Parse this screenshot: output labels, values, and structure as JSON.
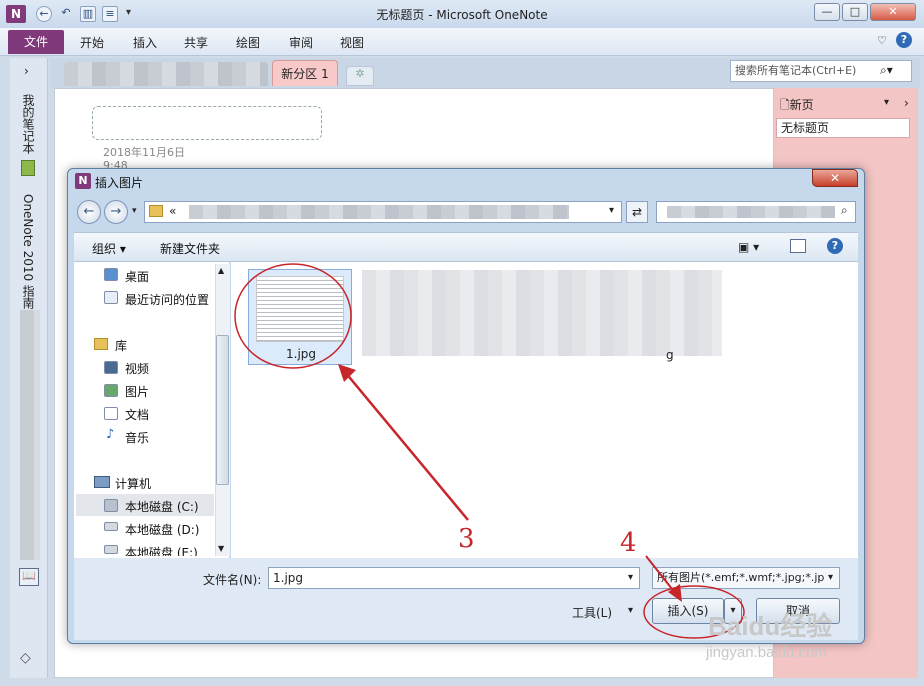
{
  "window": {
    "title": "无标题页 - Microsoft OneNote",
    "logo_letter": "N"
  },
  "ribbon": {
    "file": "文件",
    "tabs": [
      "开始",
      "插入",
      "共享",
      "绘图",
      "审阅",
      "视图"
    ]
  },
  "notebooks": {
    "item1": "我的笔记本",
    "item2": "OneNote 2010 指南"
  },
  "sections": {
    "active_tab": "新分区 1",
    "new_tab_symbol": "✲"
  },
  "search": {
    "placeholder": "搜索所有笔记本(Ctrl+E)"
  },
  "page": {
    "date": "2018年11月6日",
    "time": "9:48"
  },
  "pagelist": {
    "new_page": "新页",
    "current_page": "无标题页"
  },
  "dialog": {
    "title": "插入图片",
    "address_prefix": "«",
    "organize": "组织 ▾",
    "new_folder": "新建文件夹",
    "nav": {
      "favorites": [
        "桌面",
        "最近访问的位置"
      ],
      "library": "库",
      "library_items": [
        "视频",
        "图片",
        "文档",
        "音乐"
      ],
      "computer": "计算机",
      "drives": [
        "本地磁盘 (C:)",
        "本地磁盘 (D:)",
        "本地磁盘 (E:)"
      ]
    },
    "file_selected": "1.jpg",
    "file_other_label": "g",
    "filename_label": "文件名(N):",
    "filename_value": "1.jpg",
    "filetype_value": "所有图片(*.emf;*.wmf;*.jpg;*.jp",
    "tools": "工具(L)",
    "insert": "插入(S)",
    "cancel": "取消"
  },
  "annotations": {
    "step3": "3",
    "step4": "4"
  },
  "watermark": {
    "brand": "Baidu经验",
    "url": "jingyan.baidu.com"
  },
  "colors": {
    "onenote_purple": "#80397b",
    "section_pink": "#f7c9c9",
    "annotation_red": "#c7252a"
  }
}
